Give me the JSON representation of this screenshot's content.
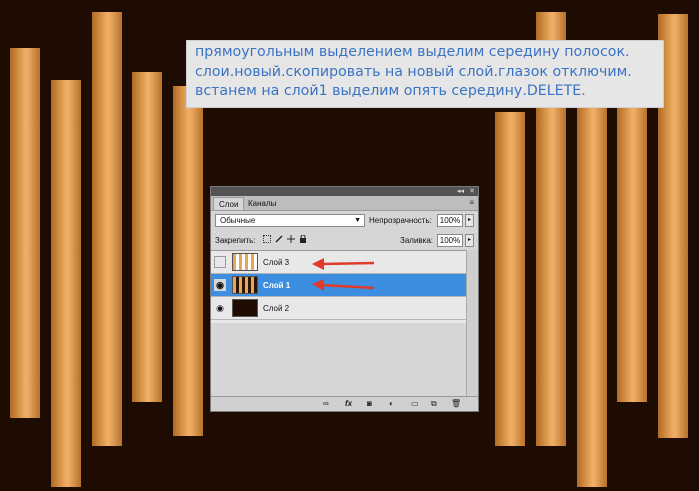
{
  "note": {
    "lines": [
      "прямоугольным выделением выделим середину полосок.",
      "слои.новый.скопировать на новый слой.глазок отключим.",
      "встанем на слой1 выделим опять середину.DELETE."
    ]
  },
  "panel": {
    "tabs": [
      "Слои",
      "Каналы"
    ],
    "blend_mode": "Обычные",
    "opacity_label": "Непрозрачность:",
    "opacity_value": "100%",
    "lock_label": "Закрепить:",
    "fill_label": "Заливка:",
    "fill_value": "100%",
    "layers": [
      {
        "name": "Слой 3",
        "visible": false,
        "selected": false
      },
      {
        "name": "Слой 1",
        "visible": true,
        "selected": true
      },
      {
        "name": "Слой 2",
        "visible": true,
        "selected": false
      }
    ]
  },
  "colors": {
    "background": "#1e0c02",
    "stripe_light": "#f0b06a",
    "stripe_dark": "#b06a22",
    "note_text": "#3b73c4",
    "selection": "#3d8ee0",
    "arrow": "#e03a2a"
  },
  "icons": {
    "bottom": [
      "link-icon",
      "fx-icon",
      "mask-icon",
      "adjustment-icon",
      "folder-icon",
      "new-layer-icon",
      "trash-icon"
    ]
  }
}
